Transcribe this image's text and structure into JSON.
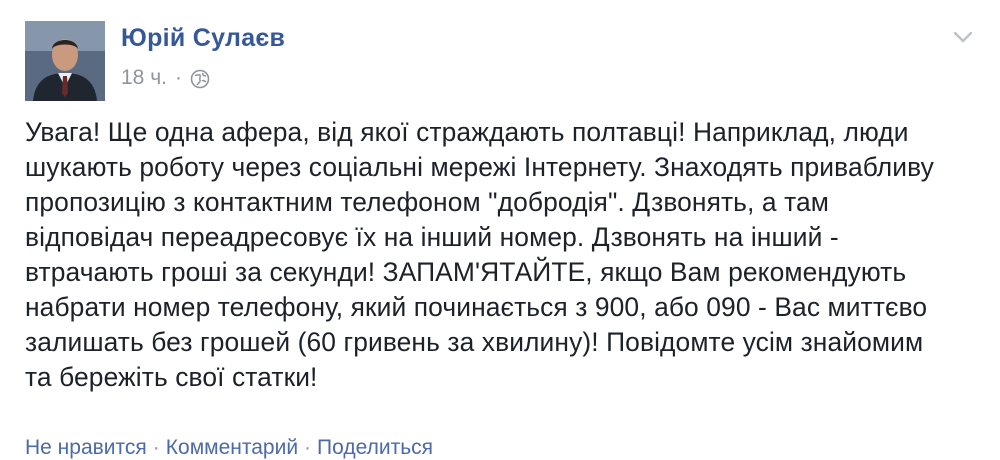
{
  "post": {
    "author": "Юрій Сулаєв",
    "time": "18 ч.",
    "meta_separator": "·",
    "privacy_icon": "globe-icon",
    "menu_icon": "chevron-down-icon",
    "text": "Увага! Ще одна афера, від якої страждають полтавці! Наприклад, люди\nшукають роботу через соціальні мережі Інтернету. Знаходять привабливу\nпропозицію з контактним телефоном \"добродія\". Дзвонять, а там\nвідповідач переадресовує їх на інший номер. Дзвонять на інший -\nвтрачають гроші за секунди! ЗАПАМ'ЯТАЙТЕ, якщо Вам рекомендують\nнабрати номер телефону, який починається з 900, або 090 - Вас миттєво\nзалишать без грошей (60 гривень за хвилину)! Повідомте усім знайомим\nта бережіть свої статки!"
  },
  "actions": {
    "like": "Не нравится",
    "comment": "Комментарий",
    "share": "Поделиться",
    "separator": "·"
  },
  "colors": {
    "author_link": "#365899",
    "action_link": "#4b6aa7",
    "meta_gray": "#90949c",
    "text": "#1d2129"
  }
}
